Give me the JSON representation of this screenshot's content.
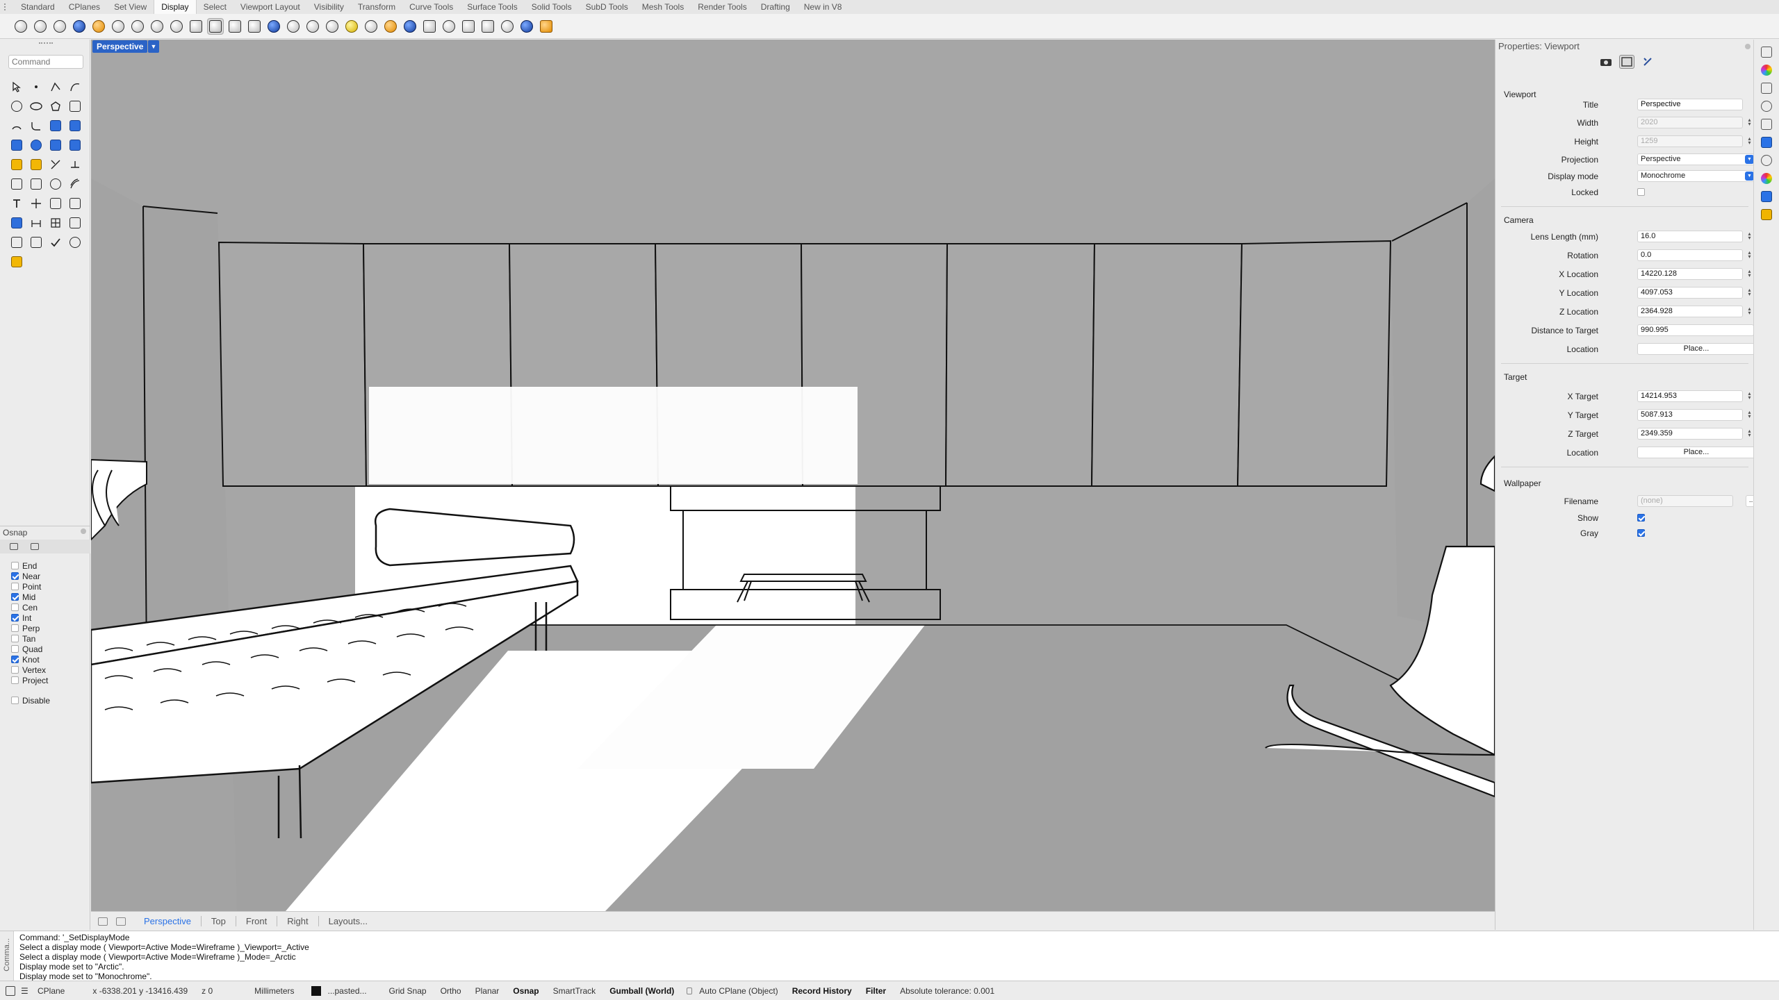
{
  "ribbon": {
    "tabs": [
      "Standard",
      "CPlanes",
      "Set View",
      "Display",
      "Select",
      "Viewport Layout",
      "Visibility",
      "Transform",
      "Curve Tools",
      "Surface Tools",
      "Solid Tools",
      "SubD Tools",
      "Mesh Tools",
      "Render Tools",
      "Drafting",
      "New in V8"
    ],
    "active_tab": "Display"
  },
  "toolbar_icons": [
    "wireframe-icon",
    "shaded-icon",
    "rendered-icon",
    "ghosted-icon",
    "xray-icon",
    "technical-icon",
    "artistic-icon",
    "pen-icon",
    "arctic-icon",
    "raytraced-icon",
    "monochrome-icon",
    "shade-icon",
    "unshade-icon",
    "show-curves-icon",
    "show-surfaces-icon",
    "show-mesh-icon",
    "show-point-cloud-icon",
    "lights-icon",
    "materials-icon",
    "display-settings-icon",
    "flat-shading-icon",
    "sun-icon",
    "shadows-icon",
    "clipping-plane-icon",
    "section-icon",
    "color-palette-icon",
    "zebra-icon",
    "environment-icon",
    "screen-icon",
    "render-icon"
  ],
  "command": {
    "placeholder": "Command",
    "history": [
      "Command: '_SetDisplayMode",
      "Select a display mode ( Viewport=Active Mode=Wireframe )_Viewport=_Active",
      "Select a display mode ( Viewport=Active Mode=Wireframe )_Mode=_Arctic",
      "Display mode set to \"Arctic\".",
      "Display mode set to \"Monochrome\"."
    ],
    "side_label": "Comma..."
  },
  "osnap": {
    "title": "Osnap",
    "items": [
      {
        "label": "End",
        "checked": false
      },
      {
        "label": "Near",
        "checked": true
      },
      {
        "label": "Point",
        "checked": false
      },
      {
        "label": "Mid",
        "checked": true
      },
      {
        "label": "Cen",
        "checked": false
      },
      {
        "label": "Int",
        "checked": true
      },
      {
        "label": "Perp",
        "checked": false
      },
      {
        "label": "Tan",
        "checked": false
      },
      {
        "label": "Quad",
        "checked": false
      },
      {
        "label": "Knot",
        "checked": true
      },
      {
        "label": "Vertex",
        "checked": false
      },
      {
        "label": "Project",
        "checked": false
      }
    ],
    "disable_label": "Disable"
  },
  "viewport": {
    "label": "Perspective",
    "tabs": [
      "Perspective",
      "Top",
      "Front",
      "Right",
      "Layouts..."
    ],
    "active_tab": "Perspective"
  },
  "properties": {
    "title": "Properties: Viewport",
    "viewport_section": "Viewport",
    "viewport": {
      "title_label": "Title",
      "title_value": "Perspective",
      "width_label": "Width",
      "width_value": "2020",
      "height_label": "Height",
      "height_value": "1259",
      "projection_label": "Projection",
      "projection_value": "Perspective",
      "display_mode_label": "Display mode",
      "display_mode_value": "Monochrome",
      "locked_label": "Locked"
    },
    "camera_section": "Camera",
    "camera": {
      "lens_label": "Lens Length (mm)",
      "lens_value": "16.0",
      "rotation_label": "Rotation",
      "rotation_value": "0.0",
      "x_label": "X Location",
      "x_value": "14220.128",
      "y_label": "Y Location",
      "y_value": "4097.053",
      "z_label": "Z Location",
      "z_value": "2364.928",
      "dist_label": "Distance to Target",
      "dist_value": "990.995",
      "location_label": "Location",
      "place_label": "Place..."
    },
    "target_section": "Target",
    "target": {
      "x_label": "X Target",
      "x_value": "14214.953",
      "y_label": "Y Target",
      "y_value": "5087.913",
      "z_label": "Z Target",
      "z_value": "2349.359",
      "location_label": "Location",
      "place_label": "Place..."
    },
    "wallpaper_section": "Wallpaper",
    "wallpaper": {
      "filename_label": "Filename",
      "filename_placeholder": "(none)",
      "browse_label": "...",
      "show_label": "Show",
      "gray_label": "Gray"
    }
  },
  "status": {
    "cplane": "CPlane",
    "coords": "x -6338.201  y -13416.439",
    "z": "z 0",
    "units": "Millimeters",
    "layer": "...pasted...",
    "grid_snap": "Grid Snap",
    "ortho": "Ortho",
    "planar": "Planar",
    "osnap": "Osnap",
    "smarttrack": "SmartTrack",
    "gumball": "Gumball (World)",
    "auto_cplane": "Auto CPlane (Object)",
    "record_history": "Record History",
    "filter": "Filter",
    "tolerance": "Absolute tolerance: 0.001"
  },
  "colors": {
    "accent": "#2b63c6",
    "viewport_bg": "#a7a7a7",
    "check_blue": "#2a72e6"
  }
}
